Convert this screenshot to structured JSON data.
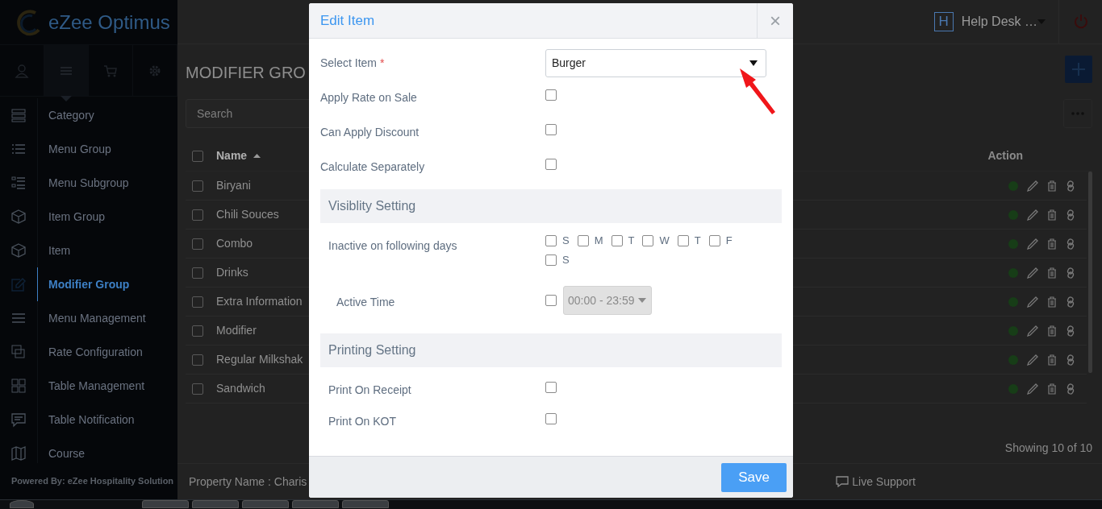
{
  "sidebar": {
    "logo": "eZee Optimus",
    "tabs": [
      {
        "selected": false
      },
      {
        "selected": true
      },
      {
        "selected": false
      },
      {
        "selected": false
      }
    ],
    "items": [
      {
        "label": "Category",
        "selected": false
      },
      {
        "label": "Menu Group",
        "selected": false
      },
      {
        "label": "Menu Subgroup",
        "selected": false
      },
      {
        "label": "Item Group",
        "selected": false
      },
      {
        "label": "Item",
        "selected": false
      },
      {
        "label": "Modifier Group",
        "selected": true
      },
      {
        "label": "Menu Management",
        "selected": false
      },
      {
        "label": "Rate Configuration",
        "selected": false
      },
      {
        "label": "Table Management",
        "selected": false
      },
      {
        "label": "Table Notification",
        "selected": false
      },
      {
        "label": "Course",
        "selected": false
      }
    ],
    "powered_by": "Powered By: eZee Hospitality Solution"
  },
  "topbar": {
    "property_badge": "H",
    "property_name": "Help Desk …"
  },
  "page": {
    "title": "MODIFIER GRO",
    "search": {
      "placeholder": "Search"
    },
    "table": {
      "select_all_checked": false,
      "columns": [
        {
          "label": "Name",
          "sorted": true
        },
        {
          "label": "Action",
          "sorted": false
        }
      ],
      "rows": [
        {
          "name": "Biryani",
          "checked": false,
          "active": true
        },
        {
          "name": "Chili Souces",
          "checked": false,
          "active": true
        },
        {
          "name": "Combo",
          "checked": false,
          "active": true
        },
        {
          "name": "Drinks",
          "checked": false,
          "active": true
        },
        {
          "name": "Extra Information",
          "checked": false,
          "active": true
        },
        {
          "name": "Modifier",
          "checked": false,
          "active": true
        },
        {
          "name": "Regular Milkshak",
          "checked": false,
          "active": true
        },
        {
          "name": "Sandwich",
          "checked": false,
          "active": true
        }
      ]
    },
    "showing": "Showing 10 of 10"
  },
  "footer": {
    "property": "Property Name : Charis",
    "live_support": "Live Support"
  },
  "modal": {
    "title": "Edit Item",
    "close": "×",
    "rows": [
      {
        "kind": "select",
        "label": "Select Item",
        "required_mark": "*",
        "value": "Burger"
      },
      {
        "kind": "checkbox",
        "label": "Apply Rate on Sale",
        "checked": false
      },
      {
        "kind": "checkbox",
        "label": "Can Apply Discount",
        "checked": false
      },
      {
        "kind": "checkbox",
        "label": "Calculate Separately",
        "checked": false
      },
      {
        "kind": "section",
        "label": "Visiblity Setting"
      },
      {
        "kind": "days",
        "label": "Inactive on following days",
        "days": [
          {
            "label": "S",
            "checked": false
          },
          {
            "label": "M",
            "checked": false
          },
          {
            "label": "T",
            "checked": false
          },
          {
            "label": "W",
            "checked": false
          },
          {
            "label": "T",
            "checked": false
          },
          {
            "label": "F",
            "checked": false
          },
          {
            "label": "S",
            "checked": false
          }
        ]
      },
      {
        "kind": "time",
        "label": "Active Time",
        "checked": false,
        "value": "00:00 - 23:59",
        "disabled": true
      },
      {
        "kind": "section",
        "label": "Printing Setting"
      },
      {
        "kind": "subcheckbox",
        "label": "Print On Receipt",
        "checked": false
      },
      {
        "kind": "subcheckbox",
        "label": "Print On KOT",
        "checked": false
      }
    ],
    "save": "Save"
  }
}
